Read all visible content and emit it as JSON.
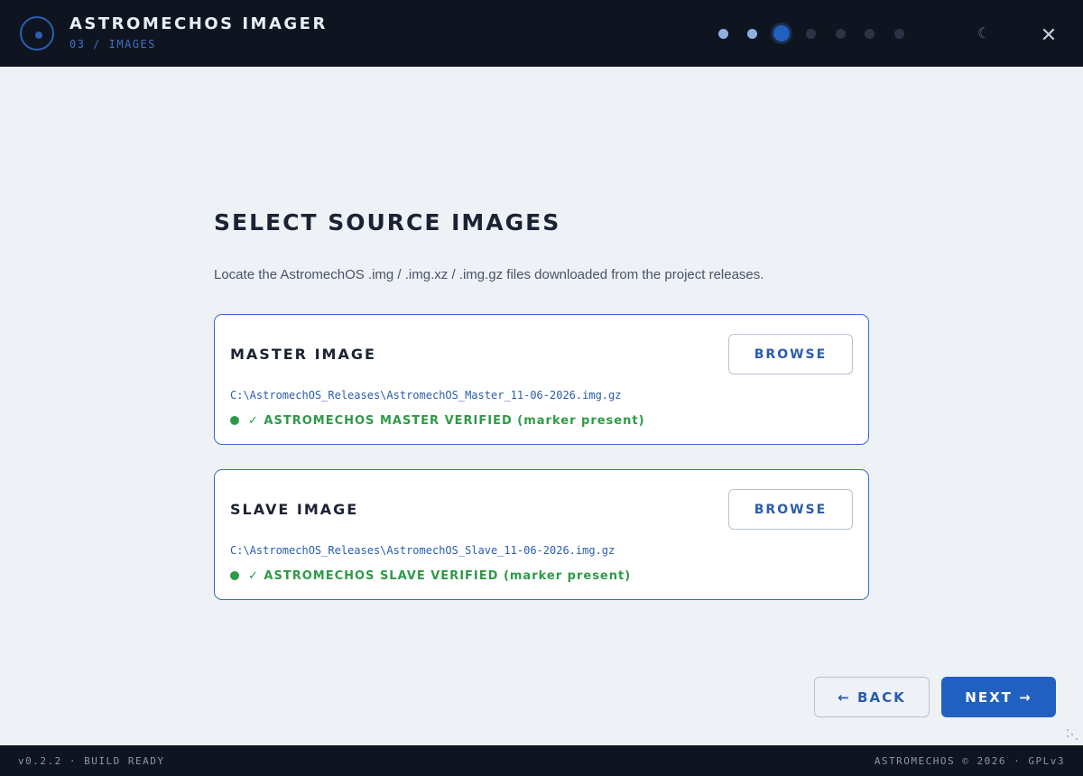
{
  "header": {
    "app_title": "ASTROMECHOS IMAGER",
    "step_label": "03 / IMAGES",
    "logo_icon": "target-ring-icon",
    "steps": {
      "total": 7,
      "current": 3,
      "completed": 2
    },
    "theme_icon": "moon-icon",
    "theme_glyph": "☾",
    "close_icon": "close-icon",
    "close_glyph": "✕"
  },
  "main": {
    "title": "SELECT SOURCE IMAGES",
    "subtitle": "Locate the AstromechOS .img / .img.xz / .img.gz files downloaded from the project releases.",
    "cards": [
      {
        "title": "MASTER IMAGE",
        "browse_label": "BROWSE",
        "path": "C:\\AstromechOS_Releases\\AstromechOS_Master_11-06-2026.img.gz",
        "status": "✓ ASTROMECHOS MASTER VERIFIED (marker present)"
      },
      {
        "title": "SLAVE IMAGE",
        "browse_label": "BROWSE",
        "path": "C:\\AstromechOS_Releases\\AstromechOS_Slave_11-06-2026.img.gz",
        "status": "✓ ASTROMECHOS SLAVE VERIFIED (marker present)"
      }
    ]
  },
  "nav": {
    "back_label": "← BACK",
    "next_label": "NEXT →"
  },
  "footer": {
    "left": "v0.2.2 · BUILD READY",
    "right": "ASTROMECHOS © 2026 · GPLv3"
  },
  "colors": {
    "accent": "#2160c0",
    "success": "#2e9a47",
    "header_bg": "#0f1520",
    "page_bg": "#eef1f6"
  }
}
